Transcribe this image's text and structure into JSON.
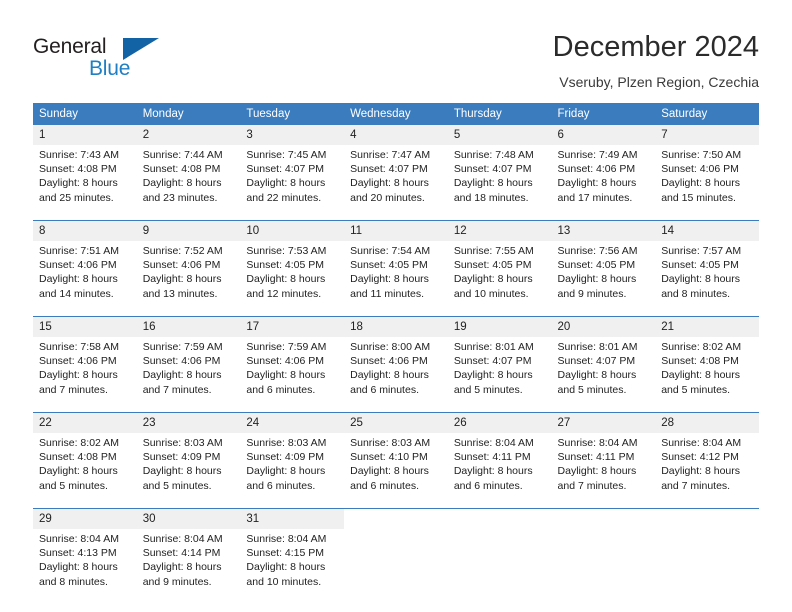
{
  "brand": {
    "word1": "General",
    "word2": "Blue",
    "flag_color": "#1263a6",
    "text_color": "#231f20",
    "accent_color": "#1f7fc4"
  },
  "header": {
    "title": "December 2024",
    "subtitle": "Vseruby, Plzen Region, Czechia"
  },
  "colors": {
    "header_row_bg": "#3a7cbe",
    "daynum_bg": "#f0f0f0",
    "cell_bg": "#ffffff",
    "divider": "#3a7cbe"
  },
  "calendar": {
    "weekday_headers": [
      "Sunday",
      "Monday",
      "Tuesday",
      "Wednesday",
      "Thursday",
      "Friday",
      "Saturday"
    ],
    "weeks": [
      {
        "days": [
          {
            "num": "1",
            "sunrise": "Sunrise: 7:43 AM",
            "sunset": "Sunset: 4:08 PM",
            "daylight1": "Daylight: 8 hours",
            "daylight2": "and 25 minutes."
          },
          {
            "num": "2",
            "sunrise": "Sunrise: 7:44 AM",
            "sunset": "Sunset: 4:08 PM",
            "daylight1": "Daylight: 8 hours",
            "daylight2": "and 23 minutes."
          },
          {
            "num": "3",
            "sunrise": "Sunrise: 7:45 AM",
            "sunset": "Sunset: 4:07 PM",
            "daylight1": "Daylight: 8 hours",
            "daylight2": "and 22 minutes."
          },
          {
            "num": "4",
            "sunrise": "Sunrise: 7:47 AM",
            "sunset": "Sunset: 4:07 PM",
            "daylight1": "Daylight: 8 hours",
            "daylight2": "and 20 minutes."
          },
          {
            "num": "5",
            "sunrise": "Sunrise: 7:48 AM",
            "sunset": "Sunset: 4:07 PM",
            "daylight1": "Daylight: 8 hours",
            "daylight2": "and 18 minutes."
          },
          {
            "num": "6",
            "sunrise": "Sunrise: 7:49 AM",
            "sunset": "Sunset: 4:06 PM",
            "daylight1": "Daylight: 8 hours",
            "daylight2": "and 17 minutes."
          },
          {
            "num": "7",
            "sunrise": "Sunrise: 7:50 AM",
            "sunset": "Sunset: 4:06 PM",
            "daylight1": "Daylight: 8 hours",
            "daylight2": "and 15 minutes."
          }
        ]
      },
      {
        "days": [
          {
            "num": "8",
            "sunrise": "Sunrise: 7:51 AM",
            "sunset": "Sunset: 4:06 PM",
            "daylight1": "Daylight: 8 hours",
            "daylight2": "and 14 minutes."
          },
          {
            "num": "9",
            "sunrise": "Sunrise: 7:52 AM",
            "sunset": "Sunset: 4:06 PM",
            "daylight1": "Daylight: 8 hours",
            "daylight2": "and 13 minutes."
          },
          {
            "num": "10",
            "sunrise": "Sunrise: 7:53 AM",
            "sunset": "Sunset: 4:05 PM",
            "daylight1": "Daylight: 8 hours",
            "daylight2": "and 12 minutes."
          },
          {
            "num": "11",
            "sunrise": "Sunrise: 7:54 AM",
            "sunset": "Sunset: 4:05 PM",
            "daylight1": "Daylight: 8 hours",
            "daylight2": "and 11 minutes."
          },
          {
            "num": "12",
            "sunrise": "Sunrise: 7:55 AM",
            "sunset": "Sunset: 4:05 PM",
            "daylight1": "Daylight: 8 hours",
            "daylight2": "and 10 minutes."
          },
          {
            "num": "13",
            "sunrise": "Sunrise: 7:56 AM",
            "sunset": "Sunset: 4:05 PM",
            "daylight1": "Daylight: 8 hours",
            "daylight2": "and 9 minutes."
          },
          {
            "num": "14",
            "sunrise": "Sunrise: 7:57 AM",
            "sunset": "Sunset: 4:05 PM",
            "daylight1": "Daylight: 8 hours",
            "daylight2": "and 8 minutes."
          }
        ]
      },
      {
        "days": [
          {
            "num": "15",
            "sunrise": "Sunrise: 7:58 AM",
            "sunset": "Sunset: 4:06 PM",
            "daylight1": "Daylight: 8 hours",
            "daylight2": "and 7 minutes."
          },
          {
            "num": "16",
            "sunrise": "Sunrise: 7:59 AM",
            "sunset": "Sunset: 4:06 PM",
            "daylight1": "Daylight: 8 hours",
            "daylight2": "and 7 minutes."
          },
          {
            "num": "17",
            "sunrise": "Sunrise: 7:59 AM",
            "sunset": "Sunset: 4:06 PM",
            "daylight1": "Daylight: 8 hours",
            "daylight2": "and 6 minutes."
          },
          {
            "num": "18",
            "sunrise": "Sunrise: 8:00 AM",
            "sunset": "Sunset: 4:06 PM",
            "daylight1": "Daylight: 8 hours",
            "daylight2": "and 6 minutes."
          },
          {
            "num": "19",
            "sunrise": "Sunrise: 8:01 AM",
            "sunset": "Sunset: 4:07 PM",
            "daylight1": "Daylight: 8 hours",
            "daylight2": "and 5 minutes."
          },
          {
            "num": "20",
            "sunrise": "Sunrise: 8:01 AM",
            "sunset": "Sunset: 4:07 PM",
            "daylight1": "Daylight: 8 hours",
            "daylight2": "and 5 minutes."
          },
          {
            "num": "21",
            "sunrise": "Sunrise: 8:02 AM",
            "sunset": "Sunset: 4:08 PM",
            "daylight1": "Daylight: 8 hours",
            "daylight2": "and 5 minutes."
          }
        ]
      },
      {
        "days": [
          {
            "num": "22",
            "sunrise": "Sunrise: 8:02 AM",
            "sunset": "Sunset: 4:08 PM",
            "daylight1": "Daylight: 8 hours",
            "daylight2": "and 5 minutes."
          },
          {
            "num": "23",
            "sunrise": "Sunrise: 8:03 AM",
            "sunset": "Sunset: 4:09 PM",
            "daylight1": "Daylight: 8 hours",
            "daylight2": "and 5 minutes."
          },
          {
            "num": "24",
            "sunrise": "Sunrise: 8:03 AM",
            "sunset": "Sunset: 4:09 PM",
            "daylight1": "Daylight: 8 hours",
            "daylight2": "and 6 minutes."
          },
          {
            "num": "25",
            "sunrise": "Sunrise: 8:03 AM",
            "sunset": "Sunset: 4:10 PM",
            "daylight1": "Daylight: 8 hours",
            "daylight2": "and 6 minutes."
          },
          {
            "num": "26",
            "sunrise": "Sunrise: 8:04 AM",
            "sunset": "Sunset: 4:11 PM",
            "daylight1": "Daylight: 8 hours",
            "daylight2": "and 6 minutes."
          },
          {
            "num": "27",
            "sunrise": "Sunrise: 8:04 AM",
            "sunset": "Sunset: 4:11 PM",
            "daylight1": "Daylight: 8 hours",
            "daylight2": "and 7 minutes."
          },
          {
            "num": "28",
            "sunrise": "Sunrise: 8:04 AM",
            "sunset": "Sunset: 4:12 PM",
            "daylight1": "Daylight: 8 hours",
            "daylight2": "and 7 minutes."
          }
        ]
      },
      {
        "days": [
          {
            "num": "29",
            "sunrise": "Sunrise: 8:04 AM",
            "sunset": "Sunset: 4:13 PM",
            "daylight1": "Daylight: 8 hours",
            "daylight2": "and 8 minutes."
          },
          {
            "num": "30",
            "sunrise": "Sunrise: 8:04 AM",
            "sunset": "Sunset: 4:14 PM",
            "daylight1": "Daylight: 8 hours",
            "daylight2": "and 9 minutes."
          },
          {
            "num": "31",
            "sunrise": "Sunrise: 8:04 AM",
            "sunset": "Sunset: 4:15 PM",
            "daylight1": "Daylight: 8 hours",
            "daylight2": "and 10 minutes."
          },
          {
            "num": "",
            "sunrise": "",
            "sunset": "",
            "daylight1": "",
            "daylight2": ""
          },
          {
            "num": "",
            "sunrise": "",
            "sunset": "",
            "daylight1": "",
            "daylight2": ""
          },
          {
            "num": "",
            "sunrise": "",
            "sunset": "",
            "daylight1": "",
            "daylight2": ""
          },
          {
            "num": "",
            "sunrise": "",
            "sunset": "",
            "daylight1": "",
            "daylight2": ""
          }
        ]
      }
    ]
  }
}
